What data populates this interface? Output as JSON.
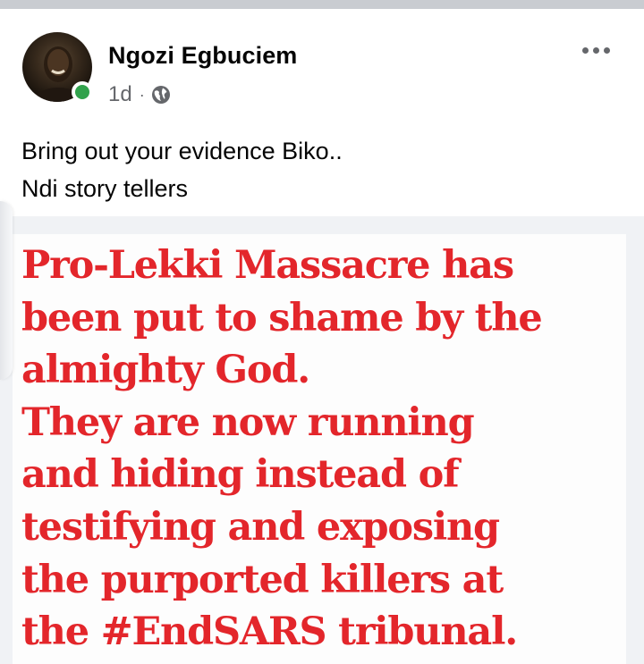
{
  "post": {
    "author": {
      "name": "Ngozi Egbuciem",
      "avatar_icon": "profile-photo",
      "online_status_color": "#31a24c"
    },
    "meta": {
      "time": "1d",
      "separator": "·",
      "privacy_icon": "globe-icon"
    },
    "more_icon": "more-horizontal-icon",
    "text_lines": [
      "Bring out your evidence Biko..",
      "Ndi story tellers"
    ],
    "image": {
      "text_color": "#e3262b",
      "lines": [
        "Pro-Lekki Massacre has",
        "been put to shame by the",
        "almighty God.",
        "They are now running",
        "and hiding instead of",
        "testifying and exposing",
        "the purported killers at",
        "the #EndSARS  tribunal."
      ]
    }
  }
}
